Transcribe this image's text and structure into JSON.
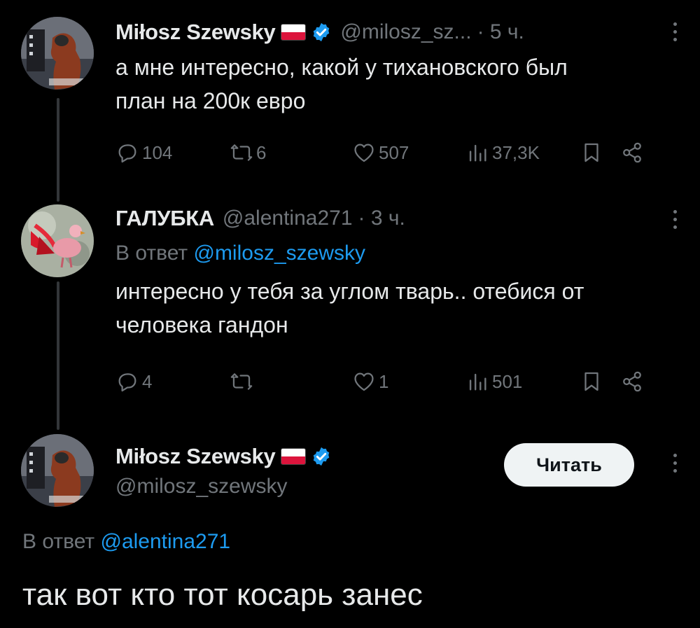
{
  "tweets": [
    {
      "name": "Miłosz Szewsky",
      "handle": "@milosz_sz...",
      "time": "· 5 ч.",
      "text_lines": [
        "а мне интересно, какой у тихановского был",
        "план на 200к евро"
      ],
      "avatar_label": "virtual reality",
      "stats": {
        "replies": "104",
        "retweets": "6",
        "likes": "507",
        "views": "37,3K"
      }
    },
    {
      "name": "ГАЛУБКА",
      "handle": "@alentina271",
      "time": "· 3 ч.",
      "reply_prefix": "В ответ",
      "reply_handle": "@milosz_szewsky",
      "text_lines": [
        "интересно у тебя за углом тварь.. отебися от",
        "человека гандон"
      ],
      "stats": {
        "replies": "4",
        "retweets": "",
        "likes": "1",
        "views": "501"
      }
    }
  ],
  "main": {
    "name": "Miłosz Szewsky",
    "handle": "@milosz_szewsky",
    "avatar_label": "virtual reality",
    "follow_label": "Читать",
    "reply_prefix": "В ответ",
    "reply_handle": "@alentina271",
    "text": "так вот кто тот косарь занес"
  },
  "colors": {
    "background": "#000000",
    "text": "#e7e9ea",
    "muted": "#71767b",
    "link": "#1d9bf0",
    "verified": "#1d9bf0",
    "flag_red": "#dc143c"
  },
  "icons": [
    "reply-icon",
    "retweet-icon",
    "like-icon",
    "views-icon",
    "bookmark-icon",
    "share-icon",
    "verified-badge-icon",
    "more-icon",
    "poland-flag-icon"
  ]
}
